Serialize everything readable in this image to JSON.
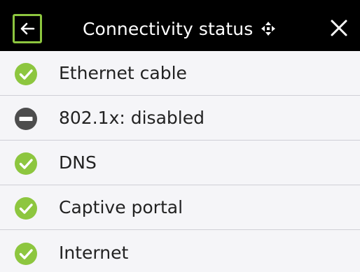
{
  "header": {
    "title": "Connectivity status",
    "back_icon": "arrow-left-icon",
    "title_icon": "move-arrows-icon",
    "close_icon": "close-icon"
  },
  "colors": {
    "header_bg": "#000000",
    "accent": "#8dc63f",
    "ok": "#8dc63f",
    "disabled": "#4d4d4d",
    "row_bg": "#f5f5f8"
  },
  "checks": [
    {
      "label": "Ethernet cable",
      "status": "ok",
      "icon": "check-circle-icon"
    },
    {
      "label": "802.1x: disabled",
      "status": "disabled",
      "icon": "minus-circle-icon"
    },
    {
      "label": "DNS",
      "status": "ok",
      "icon": "check-circle-icon"
    },
    {
      "label": "Captive portal",
      "status": "ok",
      "icon": "check-circle-icon"
    },
    {
      "label": "Internet",
      "status": "ok",
      "icon": "check-circle-icon"
    }
  ]
}
